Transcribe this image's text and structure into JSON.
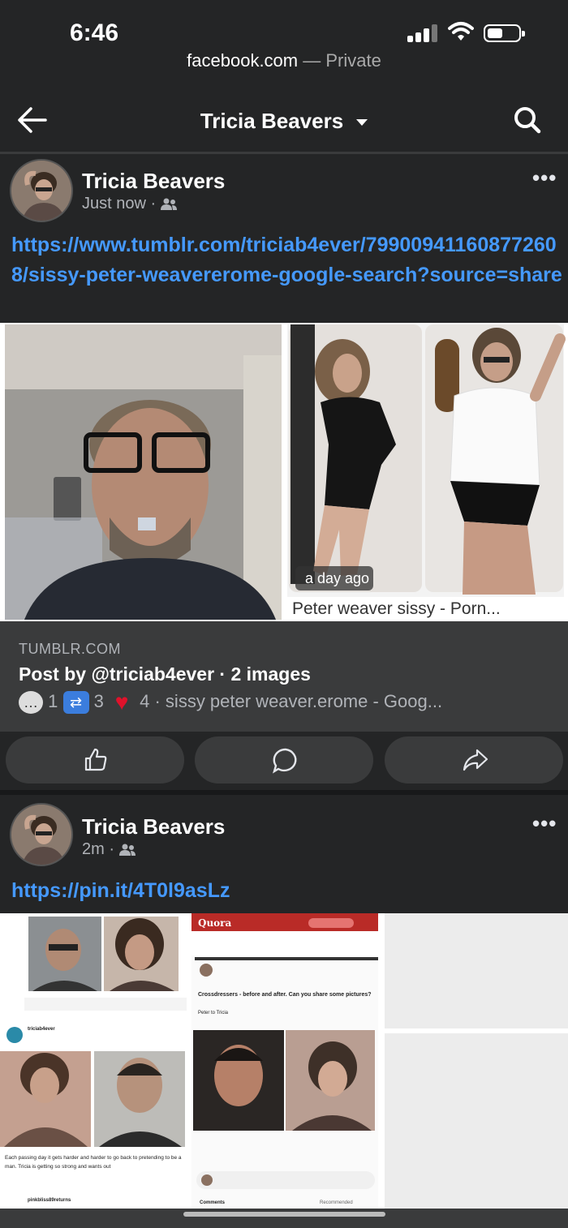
{
  "status": {
    "time": "6:46"
  },
  "browser": {
    "host": "facebook.com",
    "mode": " — Private"
  },
  "nav": {
    "title": "Tricia Beavers",
    "icons": [
      "back-arrow-icon",
      "caret-down-icon",
      "search-icon"
    ]
  },
  "posts": [
    {
      "author": "Tricia Beavers",
      "time": "Just now",
      "audience_icon": "friends-icon",
      "link": "https://www.tumblr.com/triciab4ever/799009411608772608/sissy-peter-weavererome-google-search?source=share",
      "image_caption_badge": "a day ago",
      "image_caption": "Peter weaver sissy - Porn...",
      "preview": {
        "domain": "TUMBLR.COM",
        "title": "Post by @triciab4ever · 2 images",
        "reply_count": "1",
        "reblog_count": "3",
        "like_count": "4",
        "desc": " · sissy peter weaver.erome - Goog..."
      }
    },
    {
      "author": "Tricia Beavers",
      "time": "2m",
      "audience_icon": "friends-icon",
      "link": "https://pin.it/4T0l9asLz",
      "quora": {
        "brand": "Quora",
        "question": "Crossdressers - before and after. Can you share some pictures?",
        "answer_label": "Peter to Tricia",
        "tumblr_user": "triciab4ever",
        "tumblr_caption": "Each passing day it gets harder and harder to go back to pretending to be a man. Tricia is getting so strong and wants out",
        "next_user": "pinkbliss89returns",
        "comments_label": "Comments",
        "recommended_label": "Recommended"
      }
    }
  ],
  "actions": [
    "like-icon",
    "comment-icon",
    "share-icon"
  ],
  "colors": {
    "bg": "#242526",
    "card": "#3a3b3c",
    "link": "#4599ff",
    "quora": "#b92b27"
  }
}
